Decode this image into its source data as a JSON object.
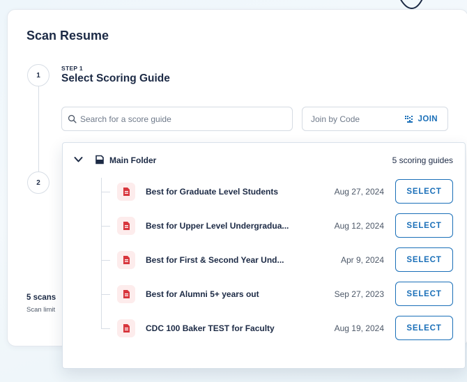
{
  "page": {
    "title": "Scan Resume",
    "steps": [
      {
        "number": "1",
        "kicker": "STEP 1",
        "title": "Select Scoring Guide"
      },
      {
        "number": "2"
      }
    ],
    "search": {
      "placeholder": "Search for a score guide",
      "value": ""
    },
    "join": {
      "placeholder": "Join by Code",
      "button_label": "JOIN"
    },
    "usage": {
      "count_label": "5 scans",
      "limit_label": "Scan limit"
    }
  },
  "dropdown": {
    "folder_name": "Main Folder",
    "folder_count": "5 scoring guides",
    "guides": [
      {
        "name": "Best for Graduate Level Students",
        "date": "Aug 27, 2024",
        "action": "SELECT"
      },
      {
        "name": "Best for Upper Level Undergradua...",
        "date": "Aug 12, 2024",
        "action": "SELECT"
      },
      {
        "name": "Best for First & Second Year Und...",
        "date": "Apr 9, 2024",
        "action": "SELECT"
      },
      {
        "name": "Best for Alumni 5+ years out",
        "date": "Sep 27, 2023",
        "action": "SELECT"
      },
      {
        "name": "CDC 100 Baker TEST for Faculty",
        "date": "Aug 19, 2024",
        "action": "SELECT"
      }
    ]
  },
  "colors": {
    "accent": "#1a6fb8",
    "doc_icon": "#d8363d",
    "doc_icon_bg": "#fdecec",
    "text": "#1c2a45"
  },
  "icons": [
    "search-icon",
    "qr-code-icon",
    "chevron-down-icon",
    "folder-icon",
    "document-icon"
  ]
}
